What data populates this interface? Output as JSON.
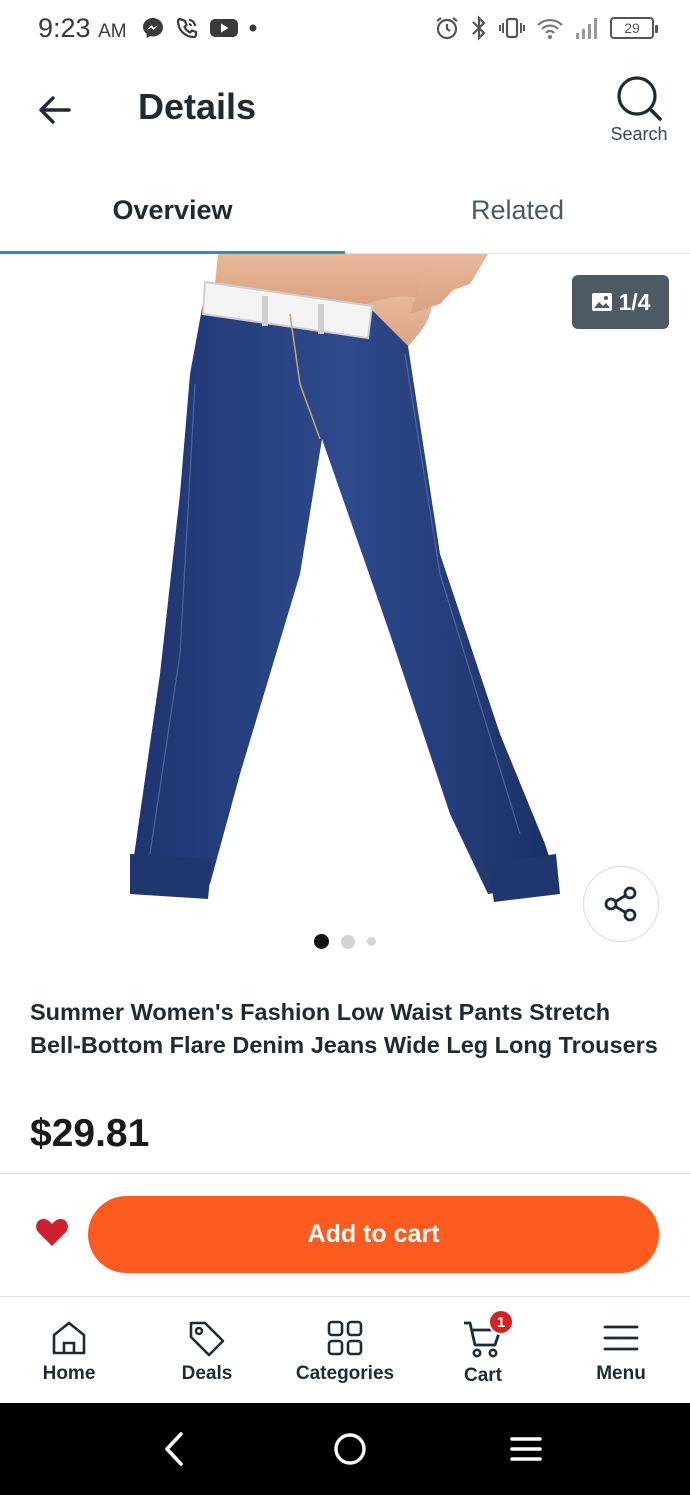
{
  "status_bar": {
    "time": "9:23",
    "ampm": "AM",
    "battery": "29"
  },
  "header": {
    "title": "Details",
    "search_label": "Search"
  },
  "tabs": [
    {
      "label": "Overview",
      "active": true
    },
    {
      "label": "Related",
      "active": false
    }
  ],
  "gallery": {
    "counter": "1/4",
    "dots_total": 3,
    "dots_active_index": 0
  },
  "product": {
    "title": "Summer Women's Fashion Low Waist Pants Stretch Bell-Bottom Flare Denim Jeans Wide Leg Long Trousers",
    "price": "$29.81"
  },
  "actions": {
    "add_to_cart": "Add to cart",
    "favorite_color": "#d01f2e",
    "button_color": "#fe5b21"
  },
  "bottom_nav": {
    "items": [
      {
        "label": "Home",
        "icon": "home-icon"
      },
      {
        "label": "Deals",
        "icon": "tag-icon"
      },
      {
        "label": "Categories",
        "icon": "grid-icon"
      },
      {
        "label": "Cart",
        "icon": "cart-icon"
      },
      {
        "label": "Menu",
        "icon": "menu-icon"
      }
    ],
    "cart_count": "1"
  }
}
